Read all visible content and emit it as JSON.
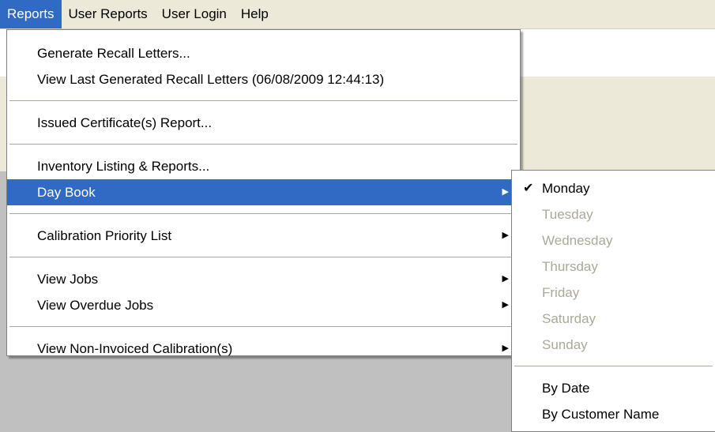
{
  "menubar": {
    "items": [
      {
        "label": "Reports"
      },
      {
        "label": "User Reports"
      },
      {
        "label": "User Login"
      },
      {
        "label": "Help"
      }
    ]
  },
  "reports_menu": {
    "generate_recall_letters": "Generate Recall Letters...",
    "view_last_generated": "View Last Generated Recall Letters (06/08/2009 12:44:13)",
    "issued_certificates": "Issued Certificate(s) Report...",
    "inventory_listing": "Inventory Listing & Reports...",
    "day_book": "Day Book",
    "calibration_priority": "Calibration Priority List",
    "view_jobs": "View Jobs",
    "view_overdue_jobs": "View Overdue Jobs",
    "view_non_invoiced": "View Non-Invoiced Calibration(s)",
    "submenu_arrow": "▶"
  },
  "daybook_submenu": {
    "check_glyph": "✔",
    "days": [
      {
        "label": "Monday",
        "checked": true,
        "enabled": true
      },
      {
        "label": "Tuesday",
        "checked": false,
        "enabled": false
      },
      {
        "label": "Wednesday",
        "checked": false,
        "enabled": false
      },
      {
        "label": "Thursday",
        "checked": false,
        "enabled": false
      },
      {
        "label": "Friday",
        "checked": false,
        "enabled": false
      },
      {
        "label": "Saturday",
        "checked": false,
        "enabled": false
      },
      {
        "label": "Sunday",
        "checked": false,
        "enabled": false
      }
    ],
    "by_date": "By Date",
    "by_customer_name": "By Customer Name"
  },
  "colors": {
    "highlight": "#316ac5",
    "menubar": "#ece9d8",
    "disabled_text": "#aca899",
    "background": "#c0c0c0"
  }
}
